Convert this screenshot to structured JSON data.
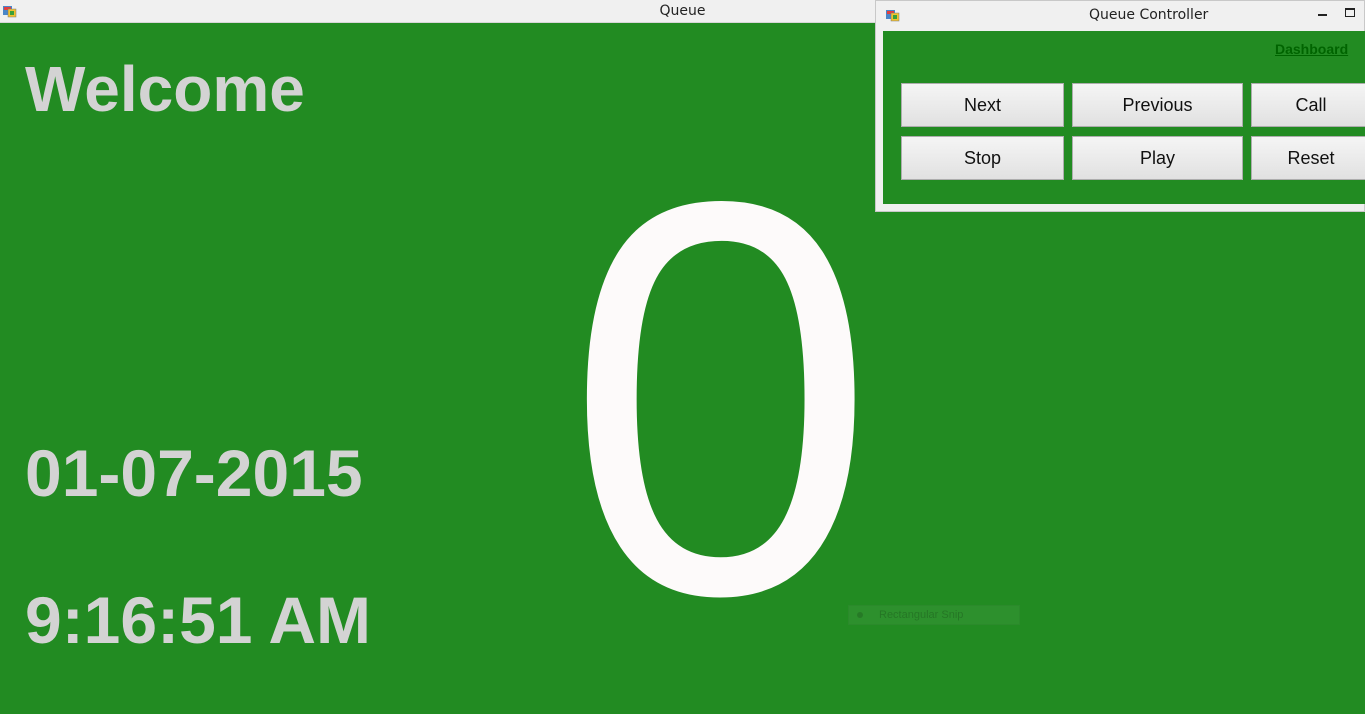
{
  "main_window": {
    "title": "Queue",
    "welcome": "Welcome",
    "date": "01-07-2015",
    "time": "9:16:51 AM",
    "queue_number": "0",
    "snip_hint": "Rectangular Snip"
  },
  "controller": {
    "title": "Queue Controller",
    "dashboard_label": "Dashboard",
    "buttons": {
      "next": "Next",
      "previous": "Previous",
      "call": "Call",
      "stop": "Stop",
      "play": "Play",
      "reset": "Reset"
    }
  },
  "colors": {
    "background": "#228b22",
    "text_light": "#d3d3d3",
    "number": "#fdfafa",
    "link": "#006400"
  }
}
